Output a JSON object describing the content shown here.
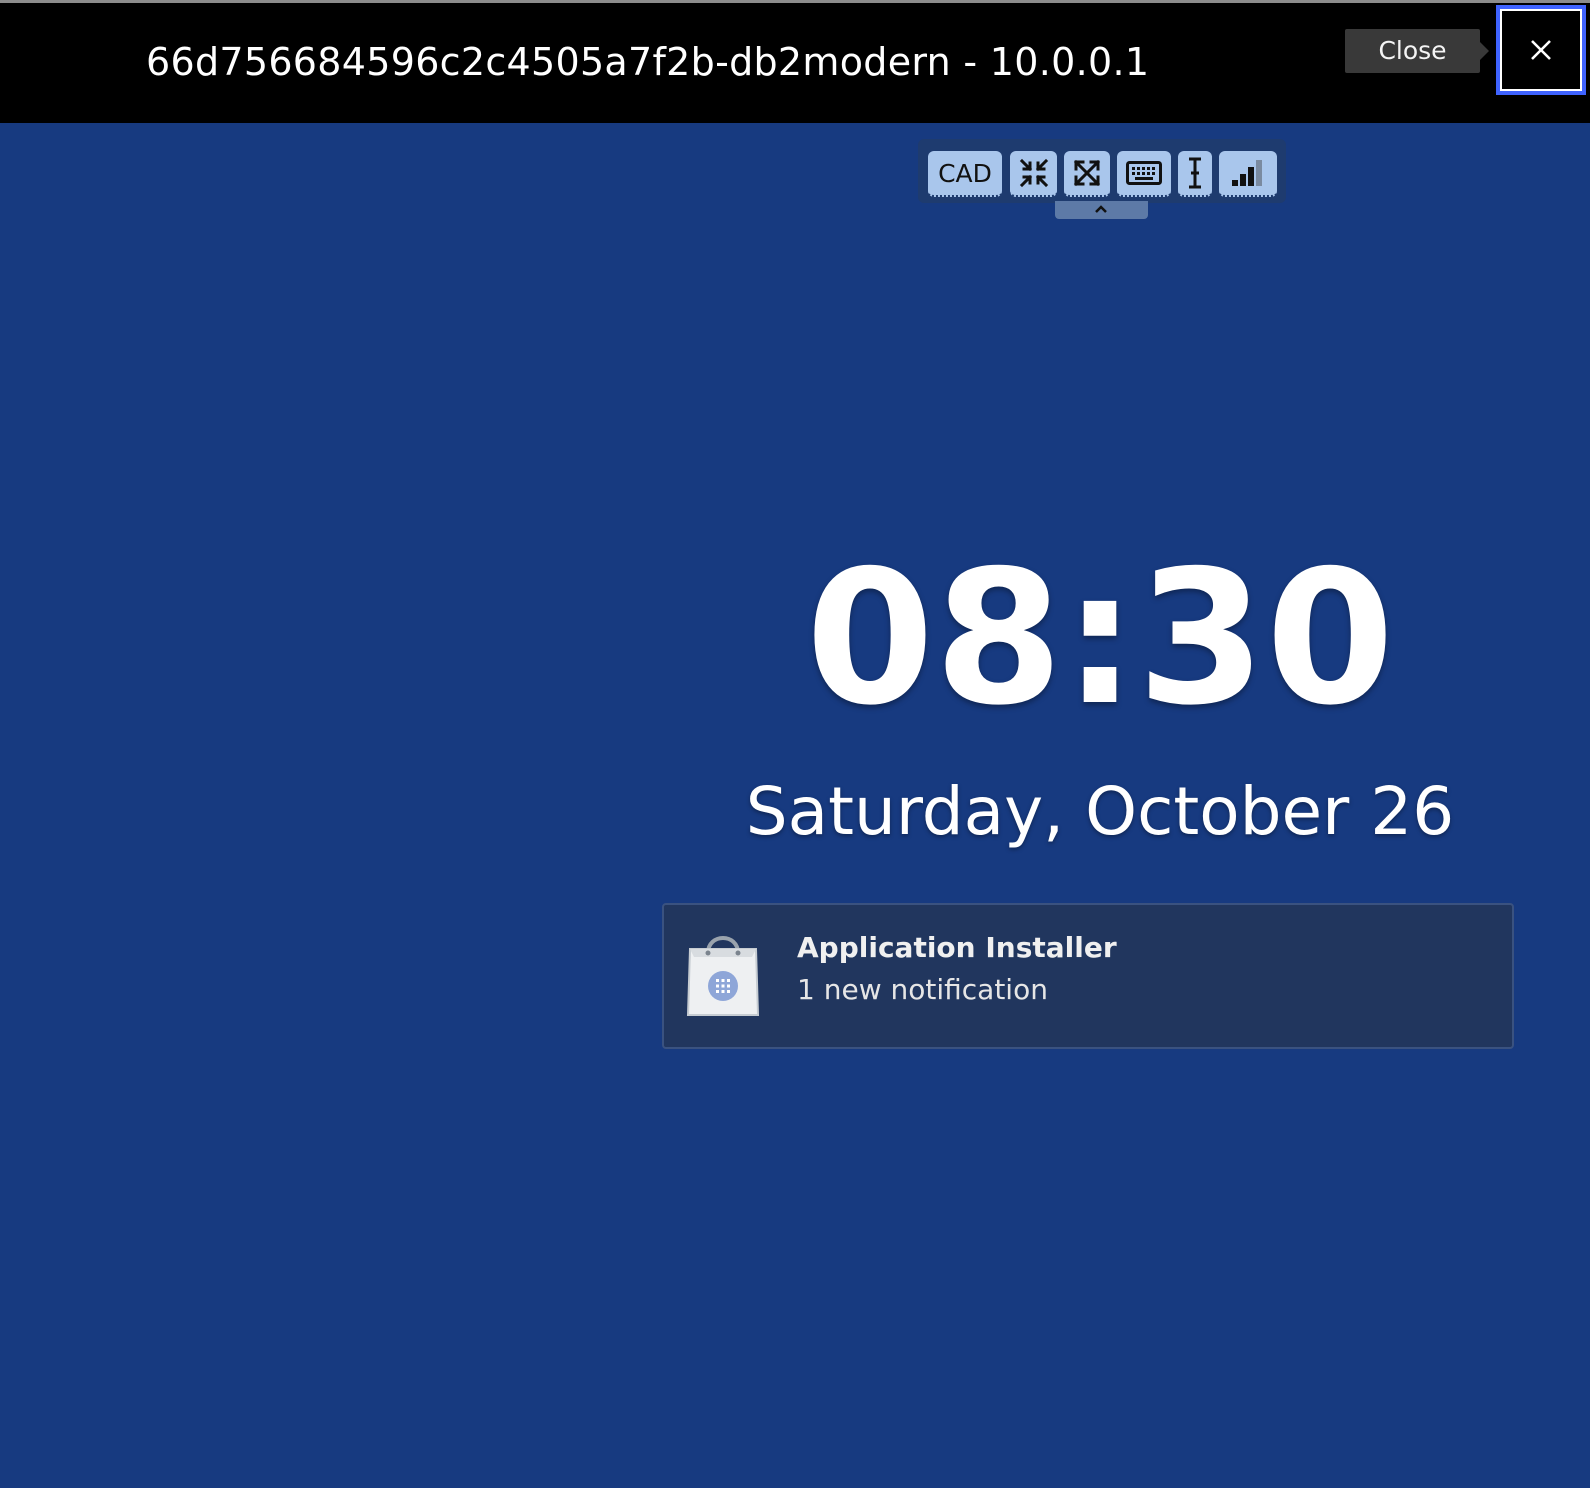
{
  "window": {
    "title": "66d756684596c2c4505a7f2b-db2modern - 10.0.0.1",
    "close_tooltip": "Close",
    "close_icon": "close-icon"
  },
  "toolbar": {
    "cad_label": "CAD",
    "buttons": [
      {
        "name": "cad",
        "icon": null
      },
      {
        "name": "exit-fullscreen",
        "icon": "compress-arrows-icon"
      },
      {
        "name": "fullscreen",
        "icon": "expand-arrows-icon"
      },
      {
        "name": "keyboard",
        "icon": "keyboard-icon"
      },
      {
        "name": "text-cursor",
        "icon": "text-cursor-icon"
      },
      {
        "name": "connection-quality",
        "icon": "signal-bars-icon"
      }
    ],
    "handle_icon": "chevron-up-icon"
  },
  "lock_screen": {
    "time": "08:30",
    "date": "Saturday, October 26"
  },
  "notification": {
    "app": "Application Installer",
    "message": "1 new notification",
    "icon": "shopping-bag-icon"
  },
  "colors": {
    "desktop_background": "#173a80",
    "header_background": "#000000",
    "focus_outline": "#3f63ff",
    "toolbar_button": "#a9c6ec",
    "notification_background": "#21365e"
  }
}
